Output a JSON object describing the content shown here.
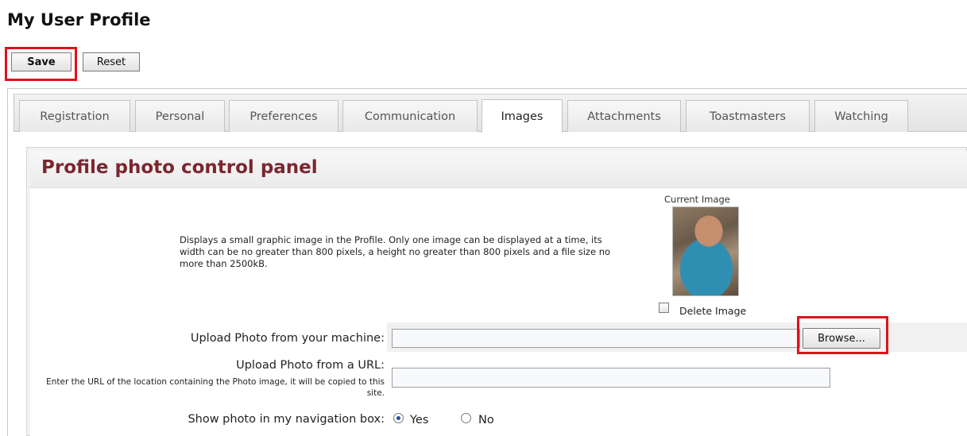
{
  "page_title": "My User Profile",
  "toolbar": {
    "save_label": "Save",
    "reset_label": "Reset"
  },
  "tabs": [
    {
      "label": "Registration",
      "active": false
    },
    {
      "label": "Personal",
      "active": false
    },
    {
      "label": "Preferences",
      "active": false
    },
    {
      "label": "Communication",
      "active": false
    },
    {
      "label": "Images",
      "active": true
    },
    {
      "label": "Attachments",
      "active": false
    },
    {
      "label": "Toastmasters",
      "active": false
    },
    {
      "label": "Watching",
      "active": false
    }
  ],
  "panel": {
    "title": "Profile photo control panel",
    "description": "Displays a small graphic image in the Profile. Only one image can be displayed at a time, its width can be no greater than 800 pixels, a height no greater than 800 pixels and a file size no more than 2500kB.",
    "current_image_label": "Current Image",
    "delete_image_label": "Delete Image",
    "delete_image_checked": false
  },
  "form": {
    "upload_machine_label": "Upload Photo from your machine:",
    "upload_machine_value": "",
    "browse_label": "Browse...",
    "upload_url_label": "Upload Photo from a URL:",
    "upload_url_hint": "Enter the URL of the location containing the Photo image, it will be copied to this site.",
    "upload_url_value": "",
    "show_photo_label": "Show photo in my navigation box:",
    "option_yes": "Yes",
    "option_no": "No",
    "show_photo_selected": "Yes"
  },
  "colors": {
    "highlight": "#e0121b",
    "panel_title": "#7a2730",
    "radio_checked": "#1d4fa8"
  }
}
